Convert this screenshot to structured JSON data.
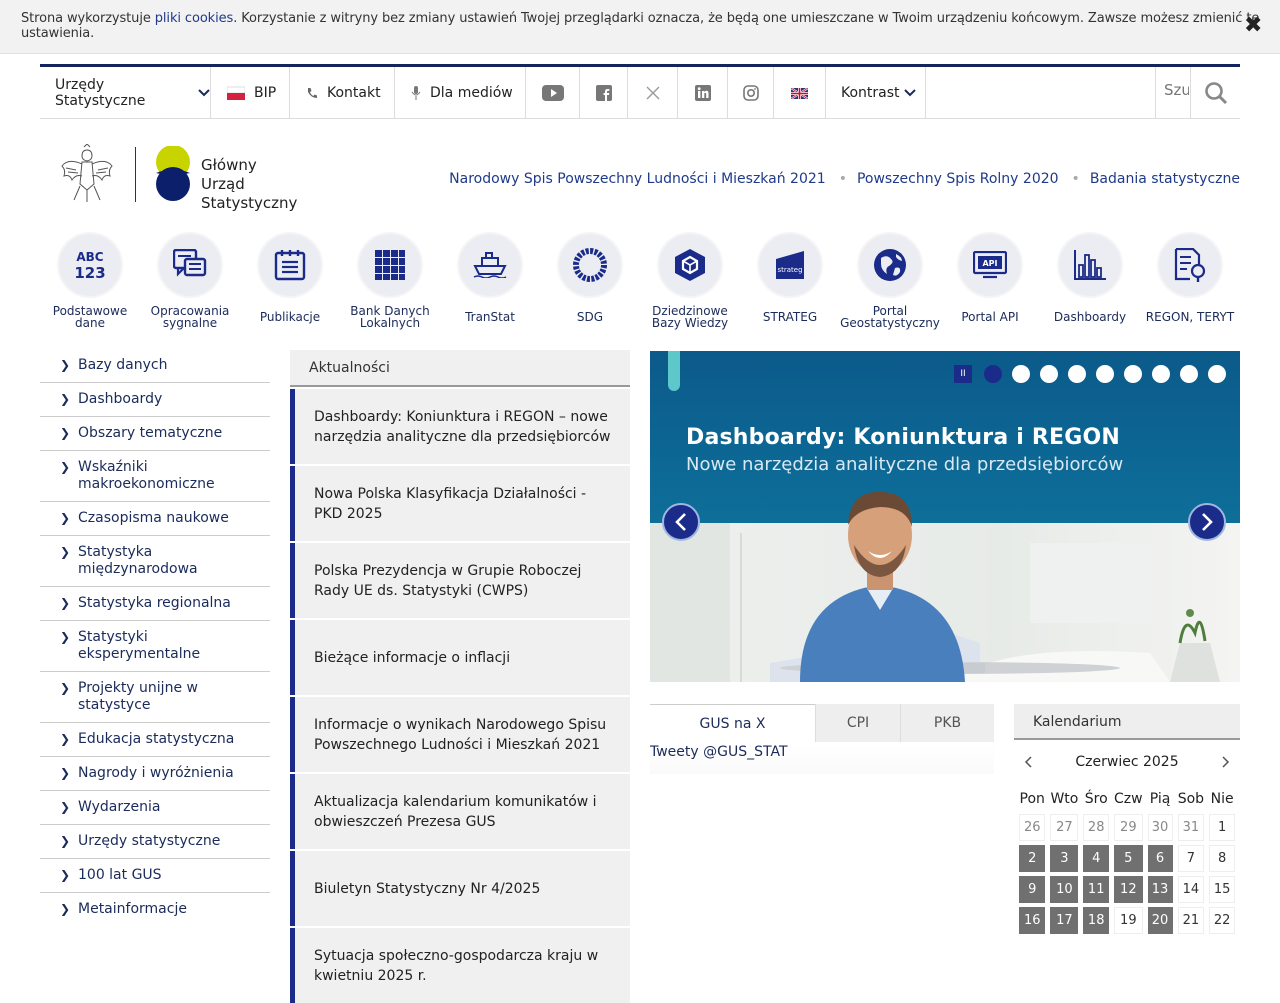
{
  "cookie": {
    "text_before": "Strona wykorzystuje ",
    "link": "pliki cookies",
    "text_after": ". Korzystanie z witryny bez zmiany ustawień Twojej przeglądarki oznacza, że będą one umieszczane w Twoim urządzeniu końcowym. Zawsze możesz zmienić te ustawienia.",
    "close": "✖"
  },
  "topbar": {
    "offices": "Urzędy Statystyczne",
    "bip": "BIP",
    "contact": "Kontakt",
    "media": "Dla mediów",
    "contrast": "Kontrast",
    "search_placeholder": "Szukaj"
  },
  "logo": {
    "line1": "Główny",
    "line2": "Urząd Statystyczny"
  },
  "top_links": [
    "Narodowy Spis Powszechny Ludności i Mieszkań 2021",
    "Powszechny Spis Rolny 2020",
    "Badania statystyczne"
  ],
  "tiles": [
    {
      "l1": "Podstawowe",
      "l2": "dane"
    },
    {
      "l1": "Opracowania",
      "l2": "sygnalne"
    },
    {
      "l1": "Publikacje",
      "l2": ""
    },
    {
      "l1": "Bank Danych",
      "l2": "Lokalnych"
    },
    {
      "l1": "TranStat",
      "l2": ""
    },
    {
      "l1": "SDG",
      "l2": ""
    },
    {
      "l1": "Dziedzinowe",
      "l2": "Bazy Wiedzy"
    },
    {
      "l1": "STRATEG",
      "l2": ""
    },
    {
      "l1": "Portal",
      "l2": "Geostatystyczny"
    },
    {
      "l1": "Portal API",
      "l2": ""
    },
    {
      "l1": "Dashboardy",
      "l2": ""
    },
    {
      "l1": "REGON, TERYT",
      "l2": ""
    }
  ],
  "leftnav": [
    "Bazy danych",
    "Dashboardy",
    "Obszary tematyczne",
    "Wskaźniki makroekonomiczne",
    "Czasopisma naukowe",
    "Statystyka międzynarodowa",
    "Statystyka regionalna",
    "Statystyki eksperymentalne",
    "Projekty unijne w statystyce",
    "Edukacja statystyczna",
    "Nagrody i wyróżnienia",
    "Wydarzenia",
    "Urzędy statystyczne",
    "100 lat GUS",
    "Metainformacje"
  ],
  "news": {
    "header": "Aktualności",
    "items": [
      "Dashboardy: Koniunktura i REGON – nowe narzędzia analityczne dla przedsiębiorców",
      "Nowa Polska Klasyfikacja Działalności - PKD 2025",
      "Polska Prezydencja w Grupie Roboczej Rady UE ds. Statystyki (CWPS)",
      "Bieżące informacje o inflacji",
      "Informacje o wynikach Narodowego Spisu Powszechnego Ludności i Mieszkań 2021",
      "Aktualizacja kalendarium komunikatów i obwieszczeń Prezesa GUS",
      "Biuletyn Statystyczny Nr 4/2025",
      "Sytuacja społeczno-gospodarcza kraju w kwietniu 2025 r."
    ]
  },
  "slider": {
    "title": "Dashboardy: Koniunktura i REGON",
    "subtitle": "Nowe narzędzia analityczne dla przedsiębiorców",
    "pause": "II",
    "slide_count": 9,
    "active_slide": 1
  },
  "tabs": [
    "GUS na X",
    "CPI",
    "PKB"
  ],
  "tweets": "Tweety @GUS_STAT",
  "calendar": {
    "header": "Kalendarium",
    "month": "Czerwiec 2025",
    "days": [
      "Pon",
      "Wto",
      "Śro",
      "Czw",
      "Pią",
      "Sob",
      "Nie"
    ],
    "weeks": [
      [
        "26",
        "27",
        "28",
        "29",
        "30",
        "31",
        "1"
      ],
      [
        "2",
        "3",
        "4",
        "5",
        "6",
        "7",
        "8"
      ],
      [
        "9",
        "10",
        "11",
        "12",
        "13",
        "14",
        "15"
      ],
      [
        "16",
        "17",
        "18",
        "19",
        "20",
        "21",
        "22"
      ]
    ]
  }
}
